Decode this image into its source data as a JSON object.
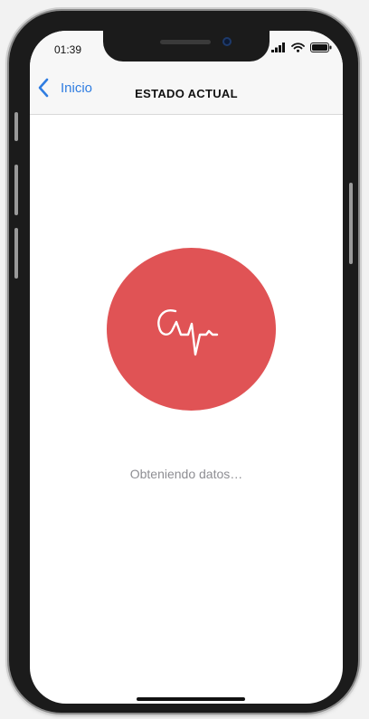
{
  "status_bar": {
    "time": "01:39"
  },
  "nav": {
    "back_label": "Inicio",
    "title": "ESTADO ACTUAL"
  },
  "main": {
    "loading_text": "Obteniendo datos…",
    "icon": "heartbeat-icon"
  },
  "colors": {
    "accent": "#2f7de1",
    "pulse": "#e05355",
    "muted_text": "#8e8e93"
  }
}
